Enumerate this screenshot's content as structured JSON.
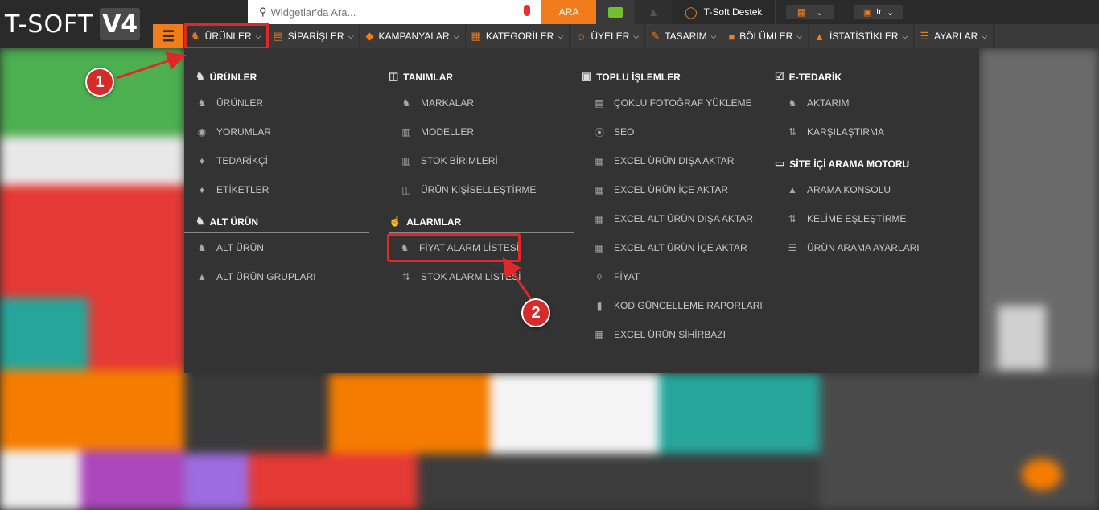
{
  "logo": {
    "text": "T-SOFT",
    "badge": "V4"
  },
  "search": {
    "placeholder": "Widgetlar'da Ara...",
    "button": "ARA"
  },
  "support": {
    "label": "T-Soft Destek"
  },
  "language": {
    "value": "tr"
  },
  "nav": {
    "items": [
      {
        "label": "ÜRÜNLER",
        "icon": "shirt-icon"
      },
      {
        "label": "SİPARİŞLER",
        "icon": "cart-icon"
      },
      {
        "label": "KAMPANYALAR",
        "icon": "tag-icon"
      },
      {
        "label": "KATEGORİLER",
        "icon": "sitemap-icon"
      },
      {
        "label": "ÜYELER",
        "icon": "users-icon"
      },
      {
        "label": "TASARIM",
        "icon": "brush-icon"
      },
      {
        "label": "BÖLÜMLER",
        "icon": "blocks-icon"
      },
      {
        "label": "İSTATİSTİKLER",
        "icon": "chart-icon"
      },
      {
        "label": "AYARLAR",
        "icon": "settings-icon"
      }
    ]
  },
  "menu": {
    "col1": {
      "head": "ÜRÜNLER",
      "items": [
        "ÜRÜNLER",
        "YORUMLAR",
        "TEDARİKÇİ",
        "ETİKETLER"
      ],
      "sub_head": "ALT ÜRÜN",
      "sub_items": [
        "ALT ÜRÜN",
        "ALT ÜRÜN GRUPLARI"
      ]
    },
    "col2": {
      "head": "TANIMLAR",
      "items": [
        "MARKALAR",
        "MODELLER",
        "STOK BİRİMLERİ",
        "ÜRÜN KİŞİSELLEŞTİRME"
      ],
      "sub_head": "ALARMLAR",
      "sub_items": [
        "FİYAT ALARM LİSTESİ",
        "STOK ALARM LİSTESİ"
      ]
    },
    "col3": {
      "head": "TOPLU İŞLEMLER",
      "items": [
        "ÇOKLU FOTOĞRAF YÜKLEME",
        "SEO",
        "EXCEL ÜRÜN DIŞA AKTAR",
        "EXCEL ÜRÜN İÇE AKTAR",
        "EXCEL ALT ÜRÜN DIŞA AKTAR",
        "EXCEL ALT ÜRÜN İÇE AKTAR",
        "FİYAT",
        "KOD GÜNCELLEME RAPORLARI",
        "EXCEL ÜRÜN SİHİRBAZI"
      ]
    },
    "col4": {
      "head": "E-TEDARİK",
      "items": [
        "AKTARIM",
        "KARŞILAŞTIRMA"
      ],
      "sub_head": "SİTE İÇİ ARAMA MOTORU",
      "sub_items": [
        "ARAMA KONSOLU",
        "KELİME EŞLEŞTİRME",
        "ÜRÜN ARAMA AYARLARI"
      ]
    }
  },
  "callouts": [
    "1",
    "2"
  ],
  "colors": {
    "accent": "#f07c1b",
    "highlight": "#e02828",
    "menu_bg": "#333333"
  }
}
